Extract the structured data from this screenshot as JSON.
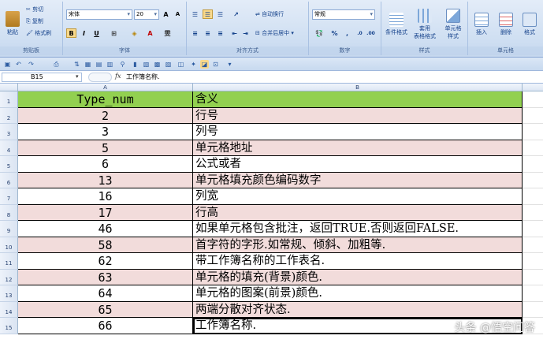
{
  "ribbon": {
    "clipboard": {
      "paste": "粘贴",
      "cut": "剪切",
      "copy": "复制",
      "format_painter": "格式刷",
      "label": "剪贴板"
    },
    "font": {
      "name": "宋体",
      "size": "20",
      "label": "字体",
      "bold": "B",
      "italic": "I",
      "underline": "U",
      "grow": "A",
      "shrink": "A"
    },
    "alignment": {
      "wrap": "自动换行",
      "merge": "合并后居中",
      "label": "对齐方式"
    },
    "number": {
      "format": "常规",
      "label": "数字",
      "percent": "%",
      "comma": ","
    },
    "styles": {
      "conditional": "条件格式",
      "table": "套用\n表格格式",
      "cell_styles": "单元格\n样式",
      "label": "样式"
    },
    "cells": {
      "insert": "插入",
      "delete": "删除",
      "format": "格式",
      "label": "单元格"
    }
  },
  "formula_bar": {
    "name_box": "B15",
    "fx": "fx",
    "content": "工作簿名称."
  },
  "columns": [
    "A",
    "B"
  ],
  "rows": [
    {
      "n": "1",
      "a": "Type_num",
      "b": "含义",
      "color": "#92d050"
    },
    {
      "n": "2",
      "a": "2",
      "b": "行号",
      "color": "#f2dcdb"
    },
    {
      "n": "3",
      "a": "3",
      "b": "列号",
      "color": "#ffffff"
    },
    {
      "n": "4",
      "a": "5",
      "b": "单元格地址",
      "color": "#f2dcdb"
    },
    {
      "n": "5",
      "a": "6",
      "b": "公式或者",
      "color": "#ffffff"
    },
    {
      "n": "6",
      "a": "13",
      "b": "单元格填充颜色编码数字",
      "color": "#f2dcdb"
    },
    {
      "n": "7",
      "a": "16",
      "b": "列宽",
      "color": "#ffffff"
    },
    {
      "n": "8",
      "a": "17",
      "b": "行高",
      "color": "#f2dcdb"
    },
    {
      "n": "9",
      "a": "46",
      "b": "如果单元格包含批注，返回TRUE.否则返回FALSE.",
      "color": "#ffffff"
    },
    {
      "n": "10",
      "a": "58",
      "b": "首字符的字形.如常规、倾斜、加粗等.",
      "color": "#f2dcdb"
    },
    {
      "n": "11",
      "a": "62",
      "b": "带工作簿名称的工作表名.",
      "color": "#ffffff"
    },
    {
      "n": "12",
      "a": "63",
      "b": "单元格的填充(背景)颜色.",
      "color": "#f2dcdb"
    },
    {
      "n": "13",
      "a": "64",
      "b": "单元格的图案(前景)颜色.",
      "color": "#ffffff"
    },
    {
      "n": "14",
      "a": "65",
      "b": "两端分散对齐状态.",
      "color": "#f2dcdb"
    },
    {
      "n": "15",
      "a": "66",
      "b": "工作簿名称.",
      "color": "#ffffff"
    }
  ],
  "watermark": "头条 @悟空问答",
  "colors": {
    "header_green": "#92d050",
    "row_pink": "#f2dcdb"
  }
}
